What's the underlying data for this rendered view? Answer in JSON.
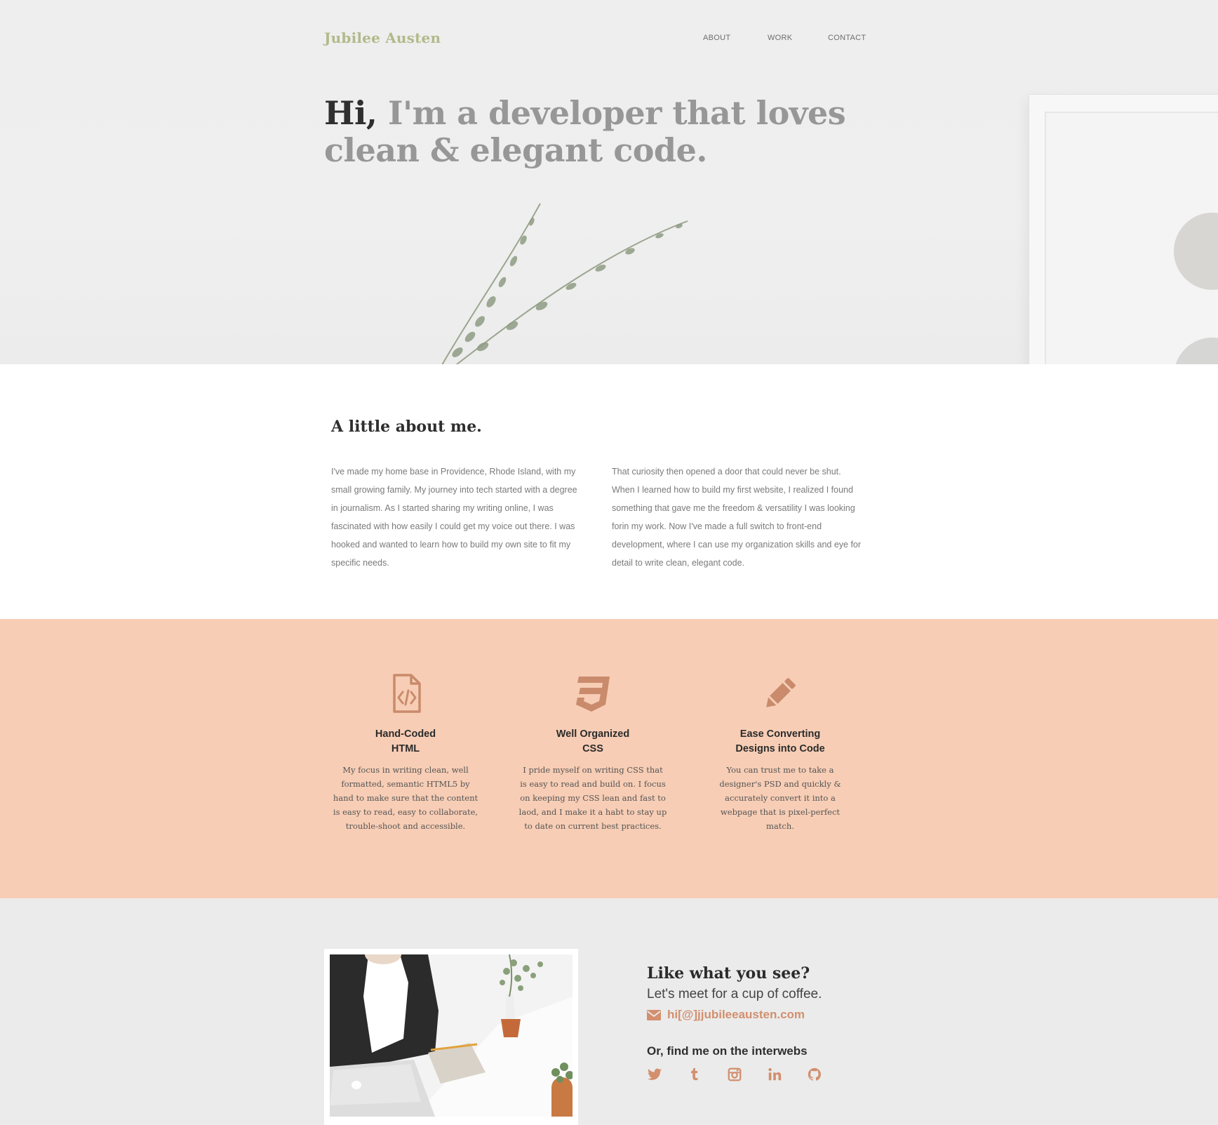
{
  "brand": {
    "name": "Jubilee Austen"
  },
  "nav": {
    "items": [
      "ABOUT",
      "WORK",
      "CONTACT"
    ]
  },
  "hero": {
    "headline_hi": "Hi,",
    "headline_rest": "I'm a developer that loves clean & elegant code."
  },
  "about": {
    "title": "A little about me.",
    "col1": "I've made my home base in Providence, Rhode Island, with my small growing family. My journey into tech started with a degree in journalism. As I started sharing my writing online, I was fascinated with how easily I could get my voice out there. I was hooked and wanted to learn how to build my own site to fit my specific needs.",
    "col2": "That curiosity then opened a door that could never be shut. When I learned how to build my first website, I realized I found something that gave me the freedom & versatility I was looking forin my work. Now I've made a full switch to front-end development, where I can use my organization skills and eye for detail to write clean, elegant code."
  },
  "skills": [
    {
      "icon": "file-code-icon",
      "title_line1": "Hand-Coded",
      "title_line2": "HTML",
      "desc": "My focus in writing clean, well formatted, semantic HTML5 by hand to make sure that the content is easy to read, easy to collaborate, trouble-shoot and accessible."
    },
    {
      "icon": "css3-icon",
      "title_line1": "Well Organized",
      "title_line2": "CSS",
      "desc": "I pride myself on writing CSS that is easy to read and build on. I focus on keeping my CSS lean and fast to laod, and I make it a habt to stay up to date on current best practices."
    },
    {
      "icon": "pencil-icon",
      "title_line1": "Ease Converting",
      "title_line2": "Designs into Code",
      "desc": "You can trust me to take a designer's PSD and quickly & accurately convert it into a webpage that is pixel-perfect match."
    }
  ],
  "contact": {
    "title": "Like what you see?",
    "subtitle": "Let's meet for a cup of coffee.",
    "email": "hi[@]jjubileeausten.com",
    "social_title": "Or, find me on the interwebs",
    "social_icons": [
      "twitter-icon",
      "tumblr-icon",
      "instagram-icon",
      "linkedin-icon",
      "github-icon"
    ]
  },
  "colors": {
    "brand": "#b2b98a",
    "accent": "#d38f6e",
    "skills_bg": "#f7cdb5",
    "icon": "#c98b6c",
    "contact_bg": "#ebebeb"
  }
}
